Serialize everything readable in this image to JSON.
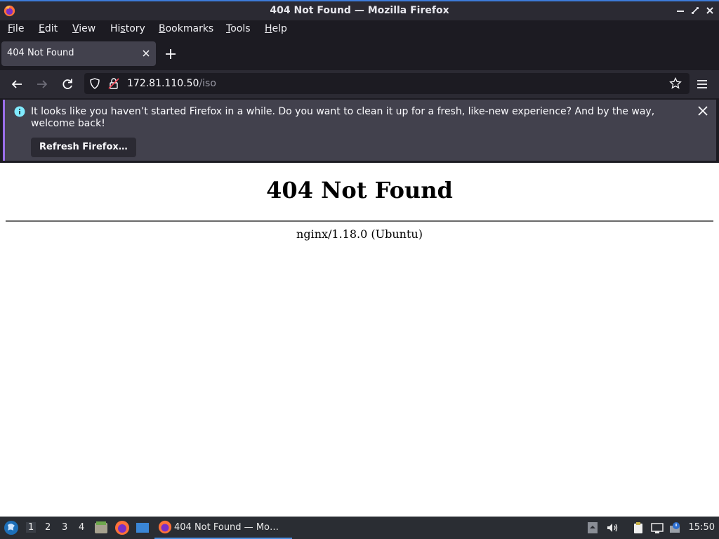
{
  "window": {
    "title": "404 Not Found — Mozilla Firefox"
  },
  "menubar": {
    "items": [
      {
        "label": "File",
        "accel": "F"
      },
      {
        "label": "Edit",
        "accel": "E"
      },
      {
        "label": "View",
        "accel": "V"
      },
      {
        "label": "History",
        "accel": "s"
      },
      {
        "label": "Bookmarks",
        "accel": "B"
      },
      {
        "label": "Tools",
        "accel": "T"
      },
      {
        "label": "Help",
        "accel": "H"
      }
    ]
  },
  "tabs": [
    {
      "title": "404 Not Found"
    }
  ],
  "urlbar": {
    "host": "172.81.110.50",
    "path": "/iso"
  },
  "notification": {
    "message": "It looks like you haven’t started Firefox in a while. Do you want to clean it up for a fresh, like-new experience? And by the way, welcome back!",
    "button": "Refresh Firefox…"
  },
  "page": {
    "heading": "404 Not Found",
    "server": "nginx/1.18.0 (Ubuntu)"
  },
  "taskbar": {
    "workspaces": [
      "1",
      "2",
      "3",
      "4"
    ],
    "active_workspace": "1",
    "task_label": "404 Not Found — Mo…",
    "clock": "15:50"
  },
  "colors": {
    "accent": "#3d7bd9",
    "notification_bar": "#9a6ee8"
  }
}
